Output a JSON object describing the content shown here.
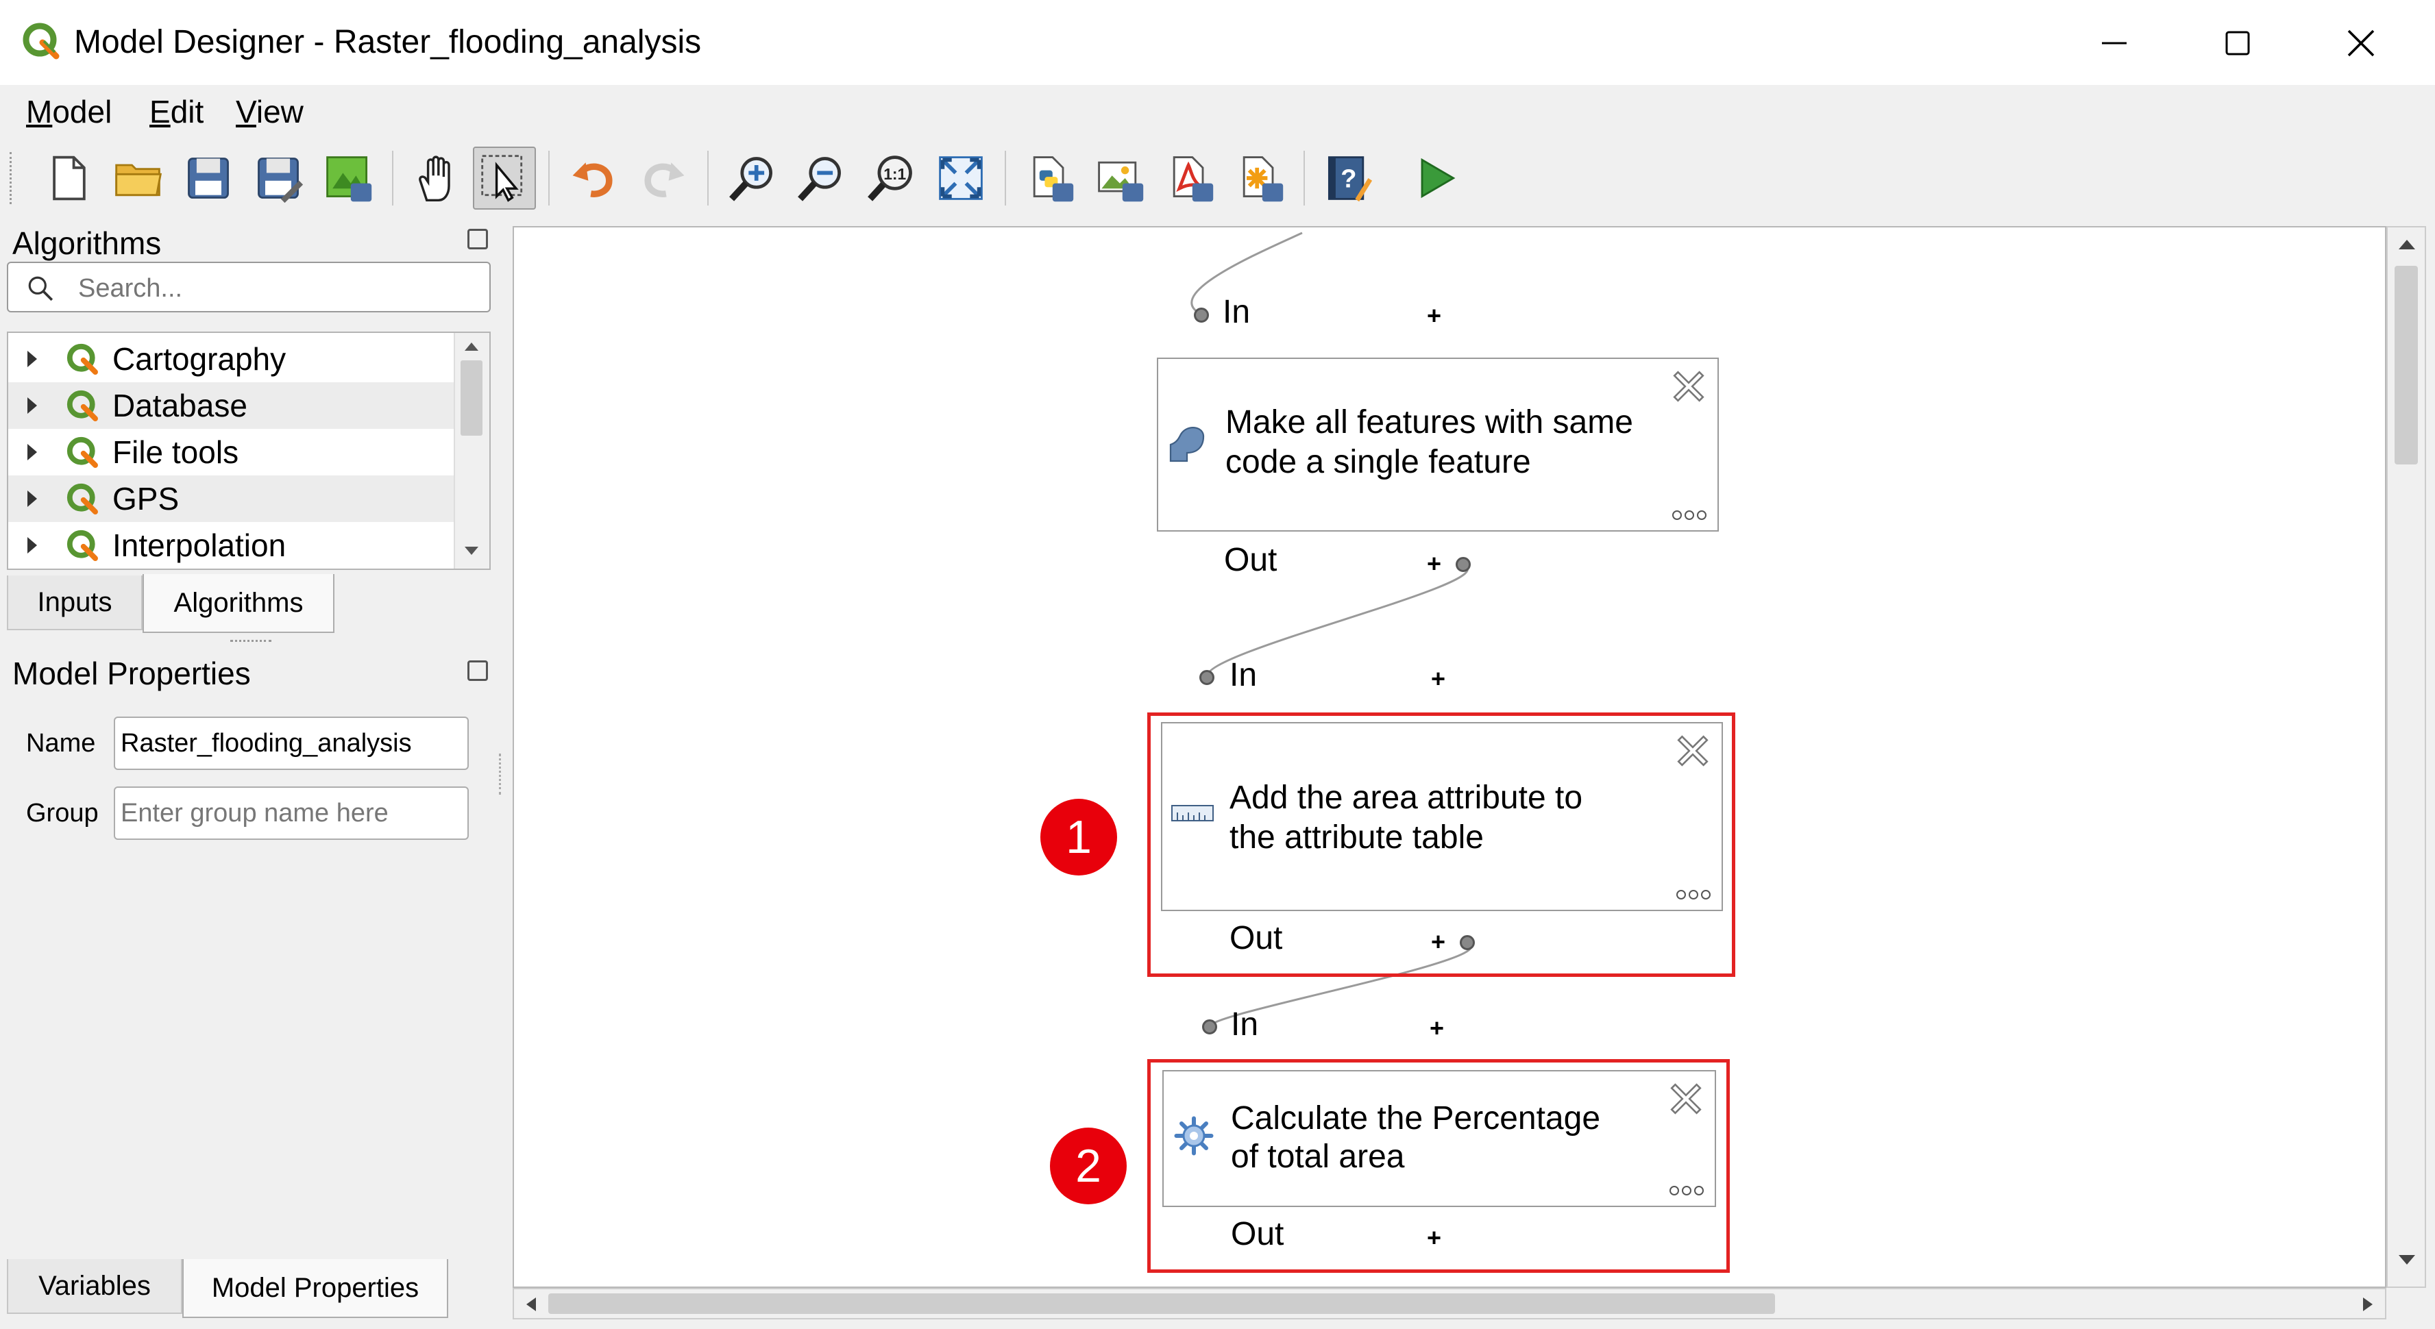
{
  "window": {
    "title": "Model Designer - Raster_flooding_analysis"
  },
  "menu": [
    "Model",
    "Edit",
    "View"
  ],
  "toolbar_icons": [
    "new-model-icon",
    "open-model-icon",
    "save-model-icon",
    "save-as-icon",
    "save-to-project-icon",
    "pan-icon",
    "select-icon",
    "undo-icon",
    "redo-icon",
    "zoom-in-icon",
    "zoom-out-icon",
    "zoom-actual-icon",
    "zoom-full-icon",
    "export-python-icon",
    "export-image-icon",
    "export-pdf-icon",
    "export-svg-icon",
    "help-icon",
    "run-model-icon"
  ],
  "algorithms_panel": {
    "title": "Algorithms",
    "search_placeholder": "Search...",
    "items": [
      "Cartography",
      "Database",
      "File tools",
      "GPS",
      "Interpolation"
    ]
  },
  "left_tabs": {
    "inputs": "Inputs",
    "algorithms": "Algorithms"
  },
  "model_properties": {
    "title": "Model Properties",
    "name_label": "Name",
    "name_value": "Raster_flooding_analysis",
    "group_label": "Group",
    "group_placeholder": "Enter group name here"
  },
  "bottom_tabs": {
    "variables": "Variables",
    "model_properties": "Model Properties"
  },
  "canvas": {
    "nodes": [
      {
        "label_line1": "Make all features with same",
        "label_line2": "code a single feature",
        "in": "In",
        "out": "Out"
      },
      {
        "label_line1": "Add the area attribute to",
        "label_line2": "the attribute table",
        "in": "In",
        "out": "Out"
      },
      {
        "label_line1": "Calculate the Percentage",
        "label_line2": "of total area",
        "in": "In",
        "out": "Out"
      }
    ],
    "plus": "+",
    "badges": [
      "1",
      "2"
    ]
  },
  "colors": {
    "highlight": "#e32222",
    "badge": "#e8000b",
    "qgis_green": "#589632"
  }
}
